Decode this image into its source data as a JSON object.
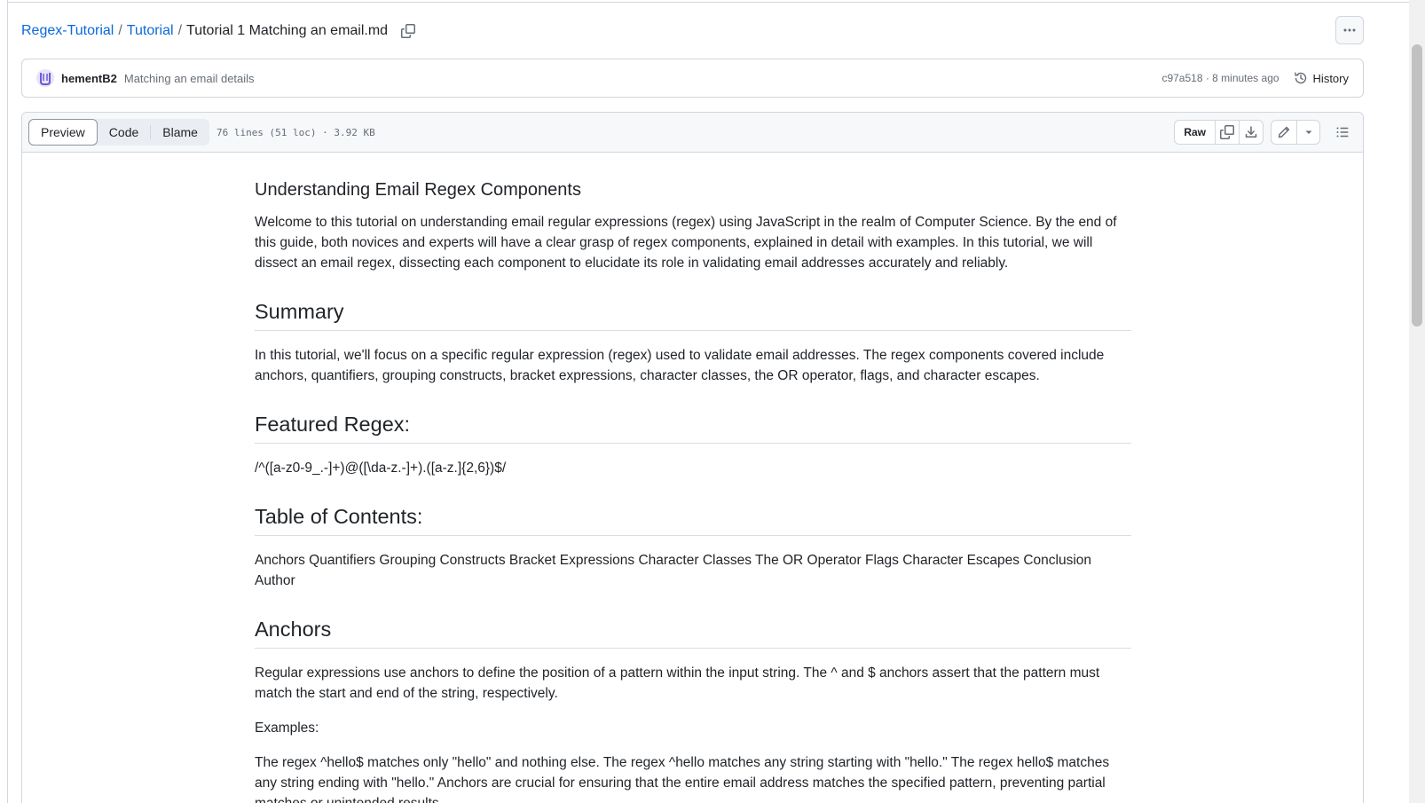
{
  "breadcrumb": {
    "repo": "Regex-Tutorial",
    "separator": "/",
    "folder": "Tutorial",
    "file": "Tutorial 1 Matching an email.md"
  },
  "commit": {
    "author": "hementB2",
    "message": "Matching an email details",
    "meta": "c97a518 · 8 minutes ago",
    "history_label": "History"
  },
  "file_header": {
    "tabs": [
      {
        "label": "Preview",
        "active": true
      },
      {
        "label": "Code",
        "active": false
      },
      {
        "label": "Blame",
        "active": false
      }
    ],
    "info": "76 lines (51 loc) · 3.92 KB",
    "raw_label": "Raw"
  },
  "icons": {
    "copy_path": "copy-icon",
    "more": "kebab-horizontal-icon",
    "history": "history-icon",
    "copy_raw": "copy-icon",
    "download": "download-icon",
    "edit": "pencil-icon",
    "edit_dropdown": "triangle-down-icon",
    "outline": "list-unordered-icon",
    "avatar": "avatar"
  },
  "colors": {
    "link": "#0969da",
    "text": "#1f2328",
    "muted": "#656d76",
    "border": "#d0d7de",
    "header_bg": "#f6f8fa"
  },
  "markdown": {
    "intro_heading": "Understanding Email Regex Components",
    "intro_text": "Welcome to this tutorial on understanding email regular expressions (regex) using JavaScript in the realm of Computer Science. By the end of this guide, both novices and experts will have a clear grasp of regex components, explained in detail with examples. In this tutorial, we will dissect an email regex, dissecting each component to elucidate its role in validating email addresses accurately and reliably.",
    "summary_heading": "Summary",
    "summary_text": "In this tutorial, we'll focus on a specific regular expression (regex) used to validate email addresses. The regex components covered include anchors, quantifiers, grouping constructs, bracket expressions, character classes, the OR operator, flags, and character escapes.",
    "featured_heading": "Featured Regex:",
    "featured_text": "/^([a-z0-9_.-]+)@([\\da-z.-]+).([a-z.]{2,6})$/",
    "toc_heading": "Table of Contents:",
    "toc_text": "Anchors Quantifiers Grouping Constructs Bracket Expressions Character Classes The OR Operator Flags Character Escapes Conclusion Author",
    "anchors_heading": "Anchors",
    "anchors_text": "Regular expressions use anchors to define the position of a pattern within the input string. The ^ and $ anchors assert that the pattern must match the start and end of the string, respectively.",
    "examples_label": "Examples:",
    "examples_text": "The regex ^hello$ matches only \"hello\" and nothing else. The regex ^hello matches any string starting with \"hello.\" The regex hello$ matches any string ending with \"hello.\" Anchors are crucial for ensuring that the entire email address matches the specified pattern, preventing partial matches or unintended results."
  }
}
